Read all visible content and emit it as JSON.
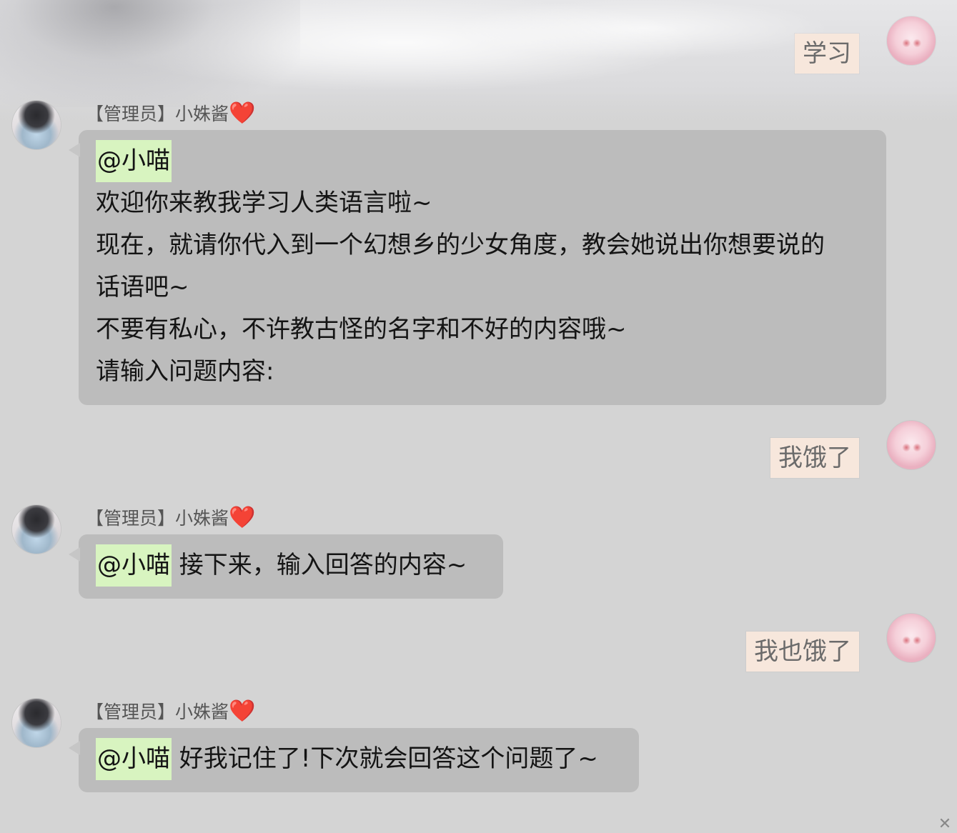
{
  "chat": {
    "messages": [
      {
        "side": "right",
        "text": "学习"
      },
      {
        "side": "left",
        "sender": "【管理员】小姝酱",
        "sender_emoji": "❤️",
        "mention": "@小喵",
        "lines": [
          "欢迎你来教我学习人类语言啦~",
          "现在，就请你代入到一个幻想乡的少女角度，教会她说出你想要说的",
          "话语吧~",
          "不要有私心，不许教古怪的名字和不好的内容哦~",
          "请输入问题内容:"
        ]
      },
      {
        "side": "right",
        "text": "我饿了"
      },
      {
        "side": "left",
        "sender": "【管理员】小姝酱",
        "sender_emoji": "❤️",
        "mention": "@小喵",
        "text": " 接下来，输入回答的内容~"
      },
      {
        "side": "right",
        "text": "我也饿了"
      },
      {
        "side": "left",
        "sender": "【管理员】小姝酱",
        "sender_emoji": "❤️",
        "mention": "@小喵",
        "text": " 好我记住了!下次就会回答这个问题了~"
      }
    ]
  },
  "icons": {
    "left_avatar": "user-avatar-admin",
    "right_avatar": "user-avatar-self",
    "close": "close-icon"
  },
  "colors": {
    "background": "#d4d4d4",
    "left_bubble": "#bcbcbc",
    "right_bubble": "#f7e7dc",
    "mention_highlight": "#d8f4c0",
    "heart": "#e0262b"
  }
}
